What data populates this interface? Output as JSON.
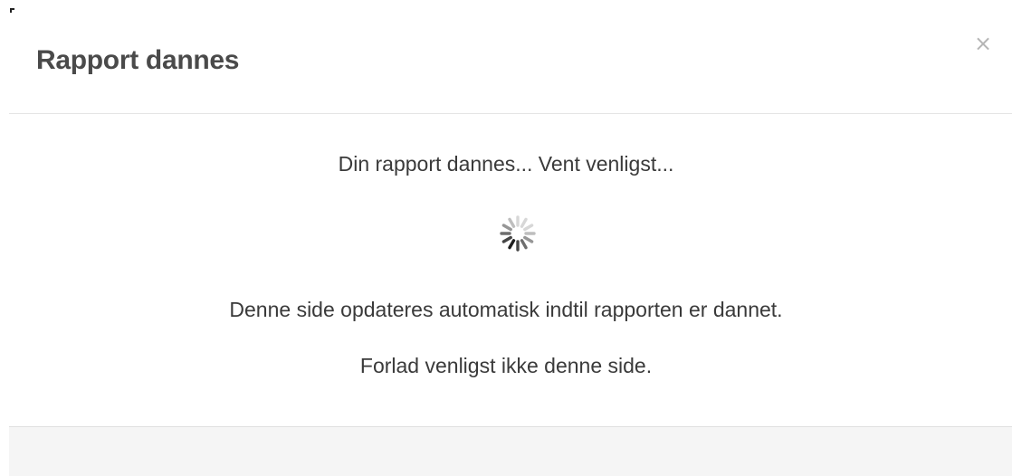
{
  "dialog": {
    "title": "Rapport dannes",
    "close_label": "×"
  },
  "body": {
    "status_main": "Din rapport dannes... Vent venligst...",
    "status_auto_update": "Denne side opdateres automatisk indtil rapporten er dannet.",
    "status_do_not_leave": "Forlad venligst ikke denne side.",
    "spinner_icon": "loading-spinner-icon"
  },
  "colors": {
    "title": "#4a4a4a",
    "text": "#3a3a3a",
    "close": "#b5b5b5",
    "footer_bg": "#f5f5f5",
    "divider": "#e5e5e5"
  }
}
